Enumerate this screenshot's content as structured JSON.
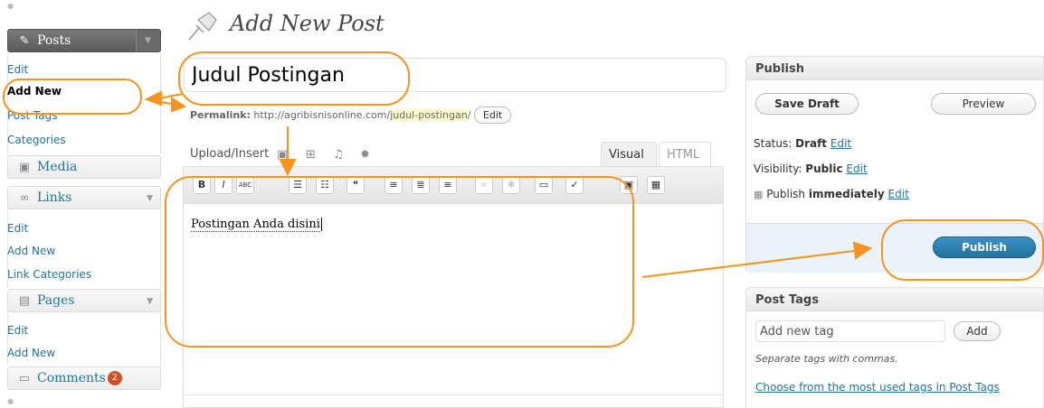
{
  "page": {
    "title": "Add New Post"
  },
  "sidebar": {
    "posts": {
      "label": "Posts",
      "items": [
        "Edit",
        "Add New",
        "Post Tags",
        "Categories"
      ]
    },
    "media": {
      "label": "Media"
    },
    "links": {
      "label": "Links",
      "items": [
        "Edit",
        "Add New",
        "Link Categories"
      ]
    },
    "pages": {
      "label": "Pages",
      "items": [
        "Edit",
        "Add New"
      ]
    },
    "comments": {
      "label": "Comments",
      "badge": "2"
    }
  },
  "editor": {
    "title_value": "Judul Postingan",
    "permalink_label": "Permalink:",
    "permalink_base": "http://agribisnisonline.com/",
    "permalink_slug": "judul-postingan",
    "permalink_trail": "/",
    "permalink_edit": "Edit",
    "upload_insert": "Upload/Insert",
    "tab_visual": "Visual",
    "tab_html": "HTML",
    "content_text": "Postingan Anda disini",
    "toolbar": [
      {
        "name": "bold-button",
        "glyph": "B"
      },
      {
        "name": "italic-button",
        "glyph": "I"
      },
      {
        "name": "strikethrough-button",
        "glyph": "ABC"
      },
      {
        "name": "unordered-list-button",
        "glyph": "☰"
      },
      {
        "name": "ordered-list-button",
        "glyph": "☷"
      },
      {
        "name": "blockquote-button",
        "glyph": "❝"
      },
      {
        "name": "align-left-button",
        "glyph": "≡"
      },
      {
        "name": "align-center-button",
        "glyph": "≣"
      },
      {
        "name": "align-right-button",
        "glyph": "≡"
      },
      {
        "name": "link-button",
        "glyph": "∞"
      },
      {
        "name": "unlink-button",
        "glyph": "✱"
      },
      {
        "name": "more-tag-button",
        "glyph": "▭"
      },
      {
        "name": "spellcheck-button",
        "glyph": "✓"
      },
      {
        "name": "fullscreen-button",
        "glyph": "▣"
      },
      {
        "name": "kitchen-sink-button",
        "glyph": "▦"
      }
    ]
  },
  "publish_box": {
    "title": "Publish",
    "save_draft": "Save Draft",
    "preview": "Preview",
    "status_label": "Status:",
    "status_value": "Draft",
    "visibility_label": "Visibility:",
    "visibility_value": "Public",
    "publish_label": "Publish",
    "publish_value": "immediately",
    "edit": "Edit",
    "publish_button": "Publish"
  },
  "tags_box": {
    "title": "Post Tags",
    "input_placeholder": "Add new tag",
    "add_button": "Add",
    "hint": "Separate tags with commas.",
    "choose_link": "Choose from the most used tags in Post Tags"
  },
  "colors": {
    "link": "#21759b",
    "annotation": "#f7941d",
    "publish_button": "#21759b"
  }
}
